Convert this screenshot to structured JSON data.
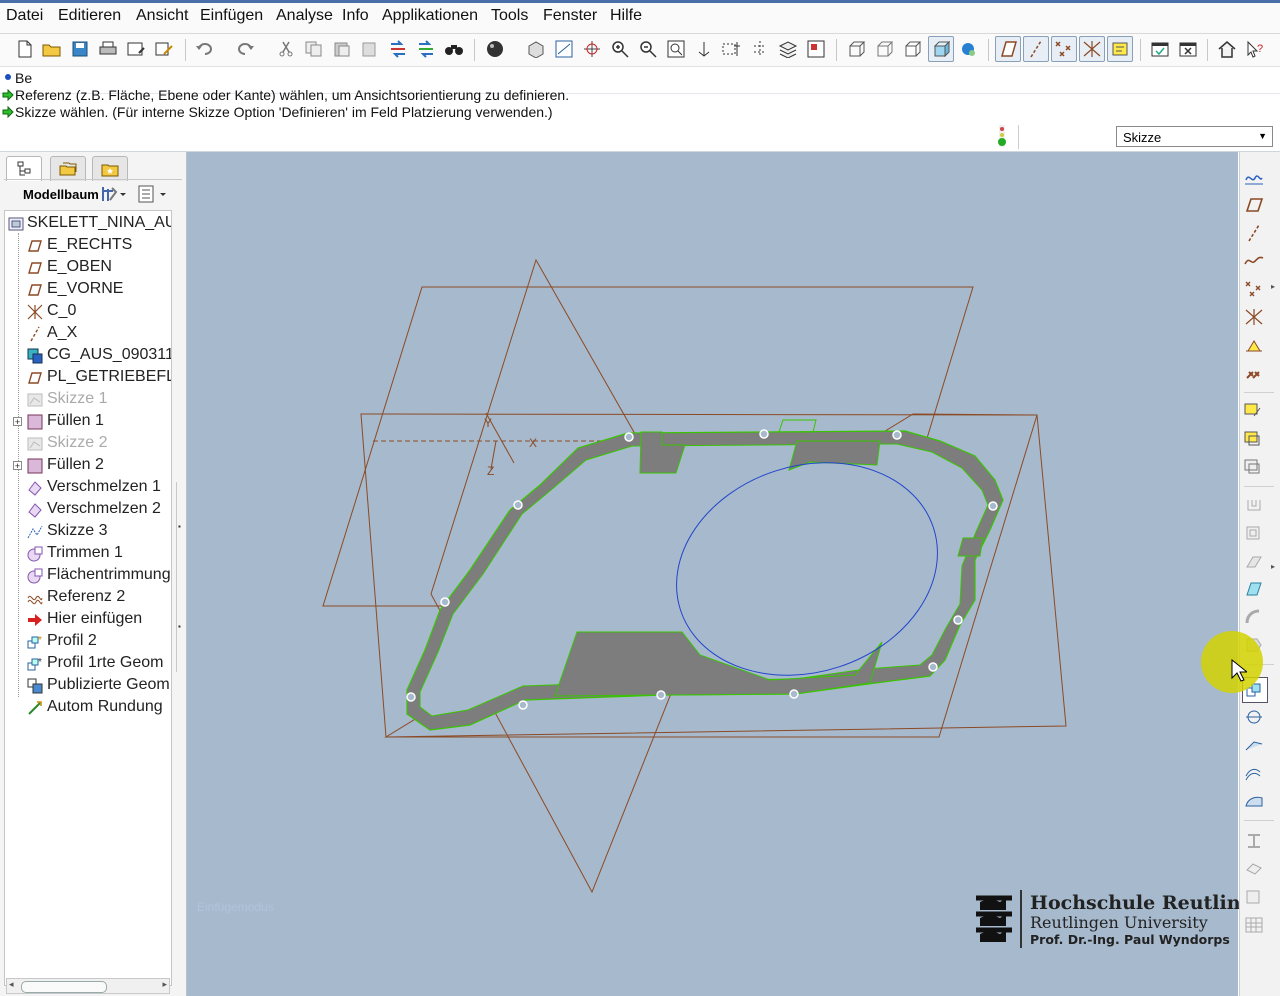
{
  "menu": [
    "Datei",
    "Editieren",
    "Ansicht",
    "Einfügen",
    "Analyse",
    "Info",
    "Applikationen",
    "Tools",
    "Fenster",
    "Hilfe"
  ],
  "messages": {
    "line1": "Be",
    "line2": "Referenz (z.B. Fläche, Ebene oder Kante) wählen, um Ansichtsorientierung zu definieren.",
    "line3": "Skizze wählen. (Für interne Skizze Option 'Definieren' im Feld Platzierung verwenden.)"
  },
  "filter": {
    "value": "Skizze"
  },
  "model_tree": {
    "header": "Modellbaum",
    "items": [
      {
        "label": "SKELETT_NINA_AU",
        "icon": "part-icon"
      },
      {
        "label": "E_RECHTS",
        "icon": "datum-plane-icon"
      },
      {
        "label": "E_OBEN",
        "icon": "datum-plane-icon"
      },
      {
        "label": "E_VORNE",
        "icon": "datum-plane-icon"
      },
      {
        "label": "C_0",
        "icon": "coordinate-system-icon"
      },
      {
        "label": "A_X",
        "icon": "datum-axis-icon"
      },
      {
        "label": "CG_AUS_090311",
        "icon": "copy-geometry-icon"
      },
      {
        "label": "PL_GETRIEBEFLA",
        "icon": "datum-plane-icon"
      },
      {
        "label": "Skizze 1",
        "icon": "sketch-icon"
      },
      {
        "label": "Füllen 1",
        "icon": "fill-icon"
      },
      {
        "label": "Skizze 2",
        "icon": "sketch-icon"
      },
      {
        "label": "Füllen 2",
        "icon": "fill-icon"
      },
      {
        "label": "Verschmelzen 1",
        "icon": "merge-icon"
      },
      {
        "label": "Verschmelzen 2",
        "icon": "merge-icon"
      },
      {
        "label": "Skizze 3",
        "icon": "sketch-icon"
      },
      {
        "label": "Trimmen 1",
        "icon": "trim-icon"
      },
      {
        "label": "Flächentrimmung",
        "icon": "trim-icon"
      },
      {
        "label": "Referenz 2",
        "icon": "curve-icon"
      },
      {
        "label": "Hier einfügen",
        "icon": "insert-here-icon"
      },
      {
        "label": "Profil 2",
        "icon": "profile-icon"
      },
      {
        "label": "Profil 1rte Geom",
        "icon": "profile-icon"
      },
      {
        "label": "Publizierte Geom",
        "icon": "publish-geometry-icon"
      },
      {
        "label": "Autom Rundung",
        "icon": "auto-round-icon"
      }
    ]
  },
  "viewport": {
    "watermark": "Einfügemodus",
    "axis_labels": {
      "y": "Y",
      "z": "Z",
      "x": "X"
    }
  },
  "logo": {
    "line1": "Hochschule Reutlingen",
    "line2": "Reutlingen University",
    "line3": "Prof. Dr.-Ing. Paul Wyndorps"
  },
  "colors": {
    "viewport_bg": "#a7b9cc",
    "datum_plane": "#8b4a25",
    "surface": "#808080",
    "edge_highlight": "#39c400",
    "sketch_blue": "#2244cc",
    "cursor_highlight": "#d2d200"
  }
}
